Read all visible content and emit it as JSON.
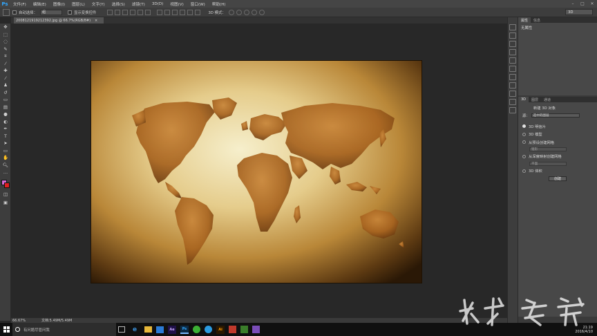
{
  "app": {
    "logo": "Ps",
    "menu": [
      "文件(F)",
      "编辑(E)",
      "图像(I)",
      "图层(L)",
      "文字(Y)",
      "选择(S)",
      "滤镜(T)",
      "3D(D)",
      "视图(V)",
      "窗口(W)",
      "帮助(H)"
    ],
    "window_controls": [
      "–",
      "□",
      "✕"
    ]
  },
  "options_bar": {
    "auto_select_label": "自动选择：",
    "auto_select_value": "组",
    "show_transform_label": "显示变换控件",
    "mode_label": "3D 模式：",
    "workspace": "3D"
  },
  "document": {
    "tab_title": "2008121919212392.jpg @ 66.7%(RGB/8#)",
    "tab_close": "×"
  },
  "status": {
    "zoom": "66.67%",
    "doc_size": "文档:5.49M/5.49M"
  },
  "properties_panel": {
    "tabs": [
      "属性",
      "信息"
    ],
    "body_text": "无属性"
  },
  "threed_panel": {
    "tabs": [
      "3D",
      "图层",
      "通道"
    ],
    "title": "新建 3D 对象",
    "source_label": "源：",
    "source_value": "选中的图层",
    "options": [
      {
        "label": "3D 明信片",
        "selected": true
      },
      {
        "label": "3D 模型",
        "selected": false
      },
      {
        "label": "从预设创建网格",
        "selected": false
      },
      {
        "label": "从深度映射创建网格",
        "selected": false
      },
      {
        "label": "3D 体积",
        "selected": false
      }
    ],
    "preset_value": "锥形",
    "depth_value": "平面",
    "create_button": "创建"
  },
  "taskbar": {
    "search_placeholder": "有问题尽管问我",
    "apps": [
      "Ae",
      "Ps",
      "Ai"
    ],
    "time": "21:19",
    "date": "2016/4/10"
  },
  "colors": {
    "foreground": "#d46ad4",
    "background": "#e02020",
    "accent": "#31a8ff"
  }
}
